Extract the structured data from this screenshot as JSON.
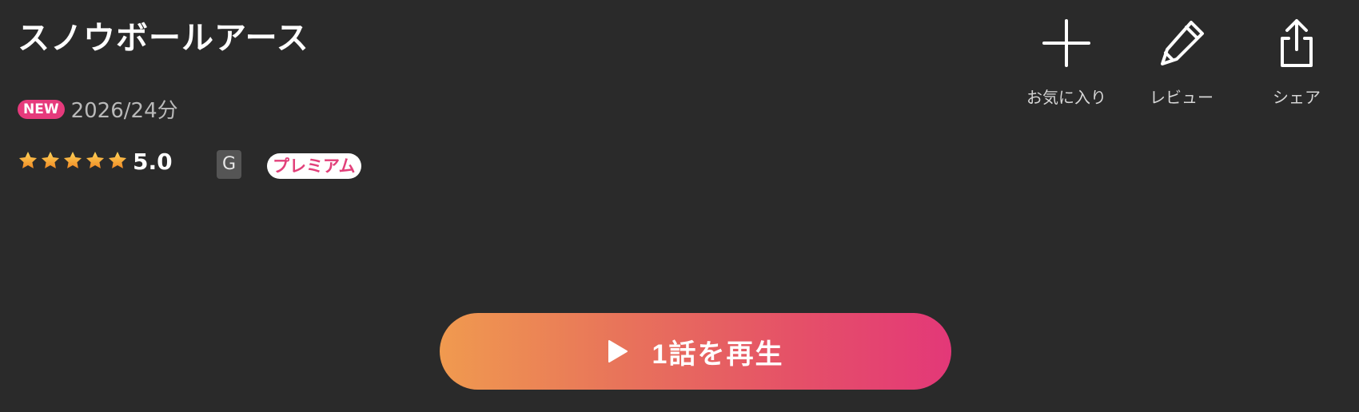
{
  "title": "スノウボールアース",
  "meta": {
    "badge": "NEW",
    "info": "2026/24分"
  },
  "rating": {
    "stars": 5,
    "score": "5.0"
  },
  "age_rating": "G",
  "premium_label": "プレミアム",
  "actions": {
    "favorite": {
      "label": "お気に入り",
      "icon": "plus-icon"
    },
    "review": {
      "label": "レビュー",
      "icon": "pencil-icon"
    },
    "share": {
      "label": "シェア",
      "icon": "share-icon"
    }
  },
  "play_button": {
    "label": "1話を再生",
    "icon": "play-icon"
  },
  "colors": {
    "background": "#2a2a2a",
    "new_badge": "#e63a7c",
    "gradient_start": "#f09a4f",
    "gradient_end": "#e33878",
    "star": "#f5a623"
  }
}
